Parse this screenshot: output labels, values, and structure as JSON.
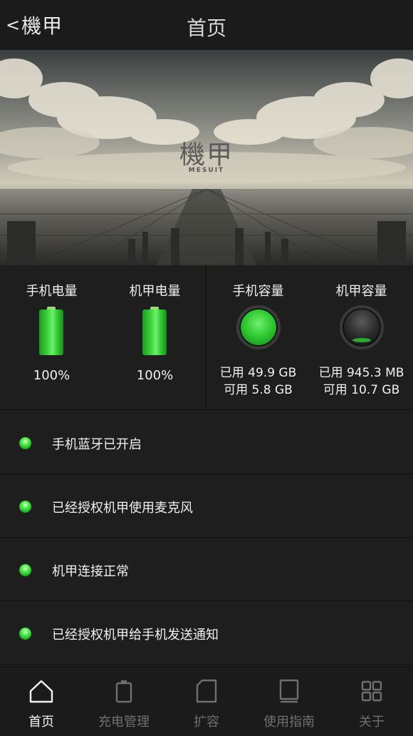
{
  "navbar": {
    "back_label": "機甲",
    "title": "首页"
  },
  "banner": {
    "logo_text": "機甲",
    "logo_subtext": "MESUIT"
  },
  "stats": {
    "phone_battery": {
      "title": "手机电量",
      "value": "100%",
      "level": 1.0
    },
    "suit_battery": {
      "title": "机甲电量",
      "value": "100%",
      "level": 1.0
    },
    "phone_storage": {
      "title": "手机容量",
      "used": "已用 49.9 GB",
      "free": "可用 5.8 GB"
    },
    "suit_storage": {
      "title": "机甲容量",
      "used": "已用 945.3 MB",
      "free": "可用 10.7 GB"
    }
  },
  "status_items": [
    {
      "label": "手机蓝牙已开启"
    },
    {
      "label": "已经授权机甲使用麦克风"
    },
    {
      "label": "机甲连接正常"
    },
    {
      "label": "已经授权机甲给手机发送通知"
    }
  ],
  "tabbar": {
    "tabs": [
      {
        "label": "首页",
        "icon": "home-icon",
        "active": true
      },
      {
        "label": "充电管理",
        "icon": "battery-icon",
        "active": false
      },
      {
        "label": "扩容",
        "icon": "sd-card-icon",
        "active": false
      },
      {
        "label": "使用指南",
        "icon": "book-icon",
        "active": false
      },
      {
        "label": "关于",
        "icon": "grid-icon",
        "active": false
      }
    ]
  },
  "colors": {
    "accent_green": "#2fc833",
    "background": "#1e1e1e",
    "bar_background": "#1b1b1b"
  }
}
